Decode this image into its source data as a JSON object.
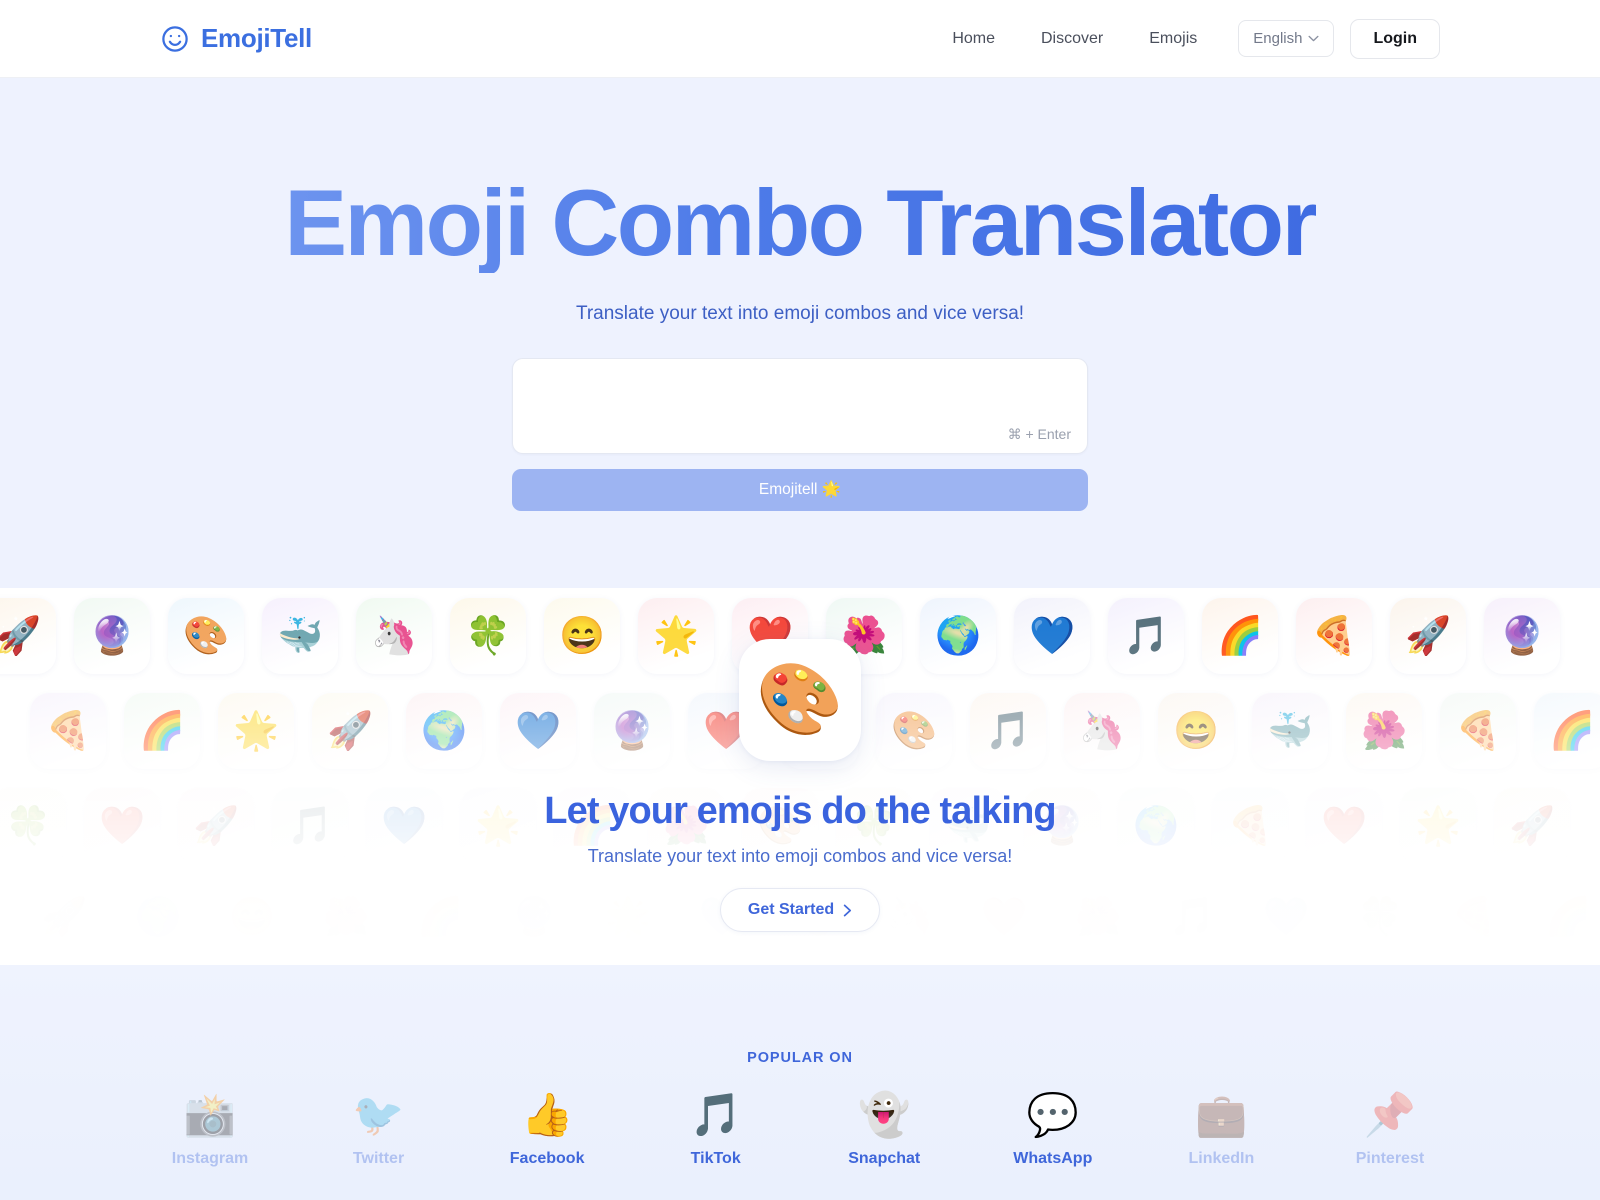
{
  "header": {
    "brand": "EmojiTell",
    "brand_icon": "smiley-face-icon",
    "nav": [
      {
        "label": "Home"
      },
      {
        "label": "Discover"
      },
      {
        "label": "Emojis"
      }
    ],
    "language": "English",
    "login_label": "Login"
  },
  "hero": {
    "title": "Emoji Combo Translator",
    "subtitle": "Translate your text into emoji combos and vice versa!",
    "input_value": "",
    "input_placeholder": "",
    "kbd_hint": "⌘ + Enter",
    "submit_label": "Emojitell 🌟",
    "accent_color": "#4d7ae8",
    "background_color": "#eef2fe",
    "submit_color": "#9db4f2"
  },
  "showcase": {
    "feature_emoji": "🎨",
    "title": "Let your emojis do the talking",
    "subtitle": "Translate your text into emoji combos and vice versa!",
    "cta_label": "Get Started",
    "cta_icon": "chevron-right-icon",
    "rows": [
      [
        "🚀",
        "🔮",
        "🎨",
        "🐳",
        "🦄",
        "🍀",
        "😄",
        "🌟",
        "❤️",
        "🌺",
        "🌍",
        "💙",
        "🎵",
        "🌈",
        "🍕",
        "🚀",
        "🔮"
      ],
      [
        "🍕",
        "🌈",
        "🌟",
        "🚀",
        "🌍",
        "💙",
        "🔮",
        "❤️",
        "🎨",
        "🎨",
        "🎵",
        "🦄",
        "😄",
        "🐳",
        "🌺",
        "🍕",
        "🌈"
      ],
      [
        "🍀",
        "❤️",
        "🚀",
        "🎵",
        "💙",
        "🌟",
        "🌈",
        "🌺",
        "🎨",
        "🍀",
        "🐳",
        "🔮",
        "🌍",
        "🍕",
        "❤️",
        "🌟",
        "🚀"
      ],
      [
        "🚀",
        "🌍",
        "😄",
        "🌺",
        "🌈",
        "🔮",
        "🌟",
        "💙",
        "🎨",
        "🦄",
        "❤️",
        "🌺",
        "🎵",
        "💙",
        "🍀",
        "🍕",
        "🌈"
      ]
    ]
  },
  "popular": {
    "label": "POPULAR ON",
    "platforms": [
      {
        "name": "Instagram",
        "glyph": "📸",
        "dim": true
      },
      {
        "name": "Twitter",
        "glyph": "🐦",
        "dim": true
      },
      {
        "name": "Facebook",
        "glyph": "👍",
        "dim": false
      },
      {
        "name": "TikTok",
        "glyph": "🎵",
        "dim": false
      },
      {
        "name": "Snapchat",
        "glyph": "👻",
        "dim": false
      },
      {
        "name": "WhatsApp",
        "glyph": "💬",
        "dim": false
      },
      {
        "name": "LinkedIn",
        "glyph": "💼",
        "dim": true
      },
      {
        "name": "Pinterest",
        "glyph": "📌",
        "dim": true
      }
    ]
  }
}
